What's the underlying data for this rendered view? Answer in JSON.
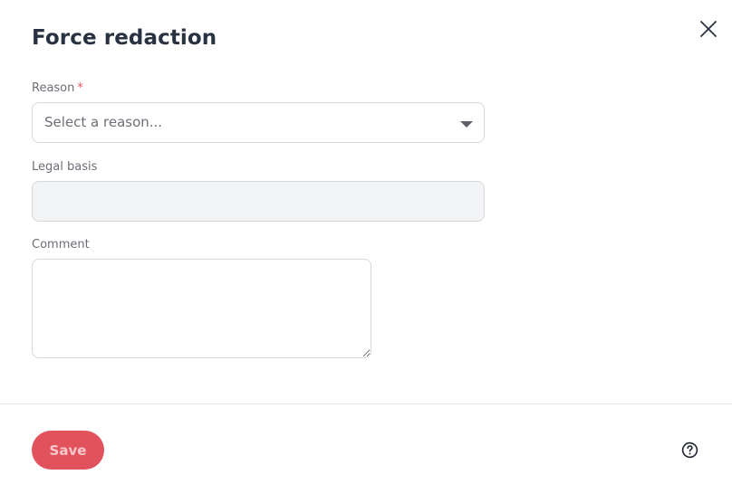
{
  "dialog": {
    "title": "Force redaction",
    "close_icon": "close-icon"
  },
  "form": {
    "reason": {
      "label": "Reason",
      "required_marker": "*",
      "placeholder": "Select a reason...",
      "dropdown_icon": "chevron-down-icon"
    },
    "legal_basis": {
      "label": "Legal basis",
      "value": ""
    },
    "comment": {
      "label": "Comment",
      "value": ""
    }
  },
  "footer": {
    "save_label": "Save",
    "help_icon": "help-circle-icon"
  },
  "colors": {
    "accent": "#e2525c",
    "text": "#283241",
    "muted": "#6b6f77",
    "border": "#d6d8dc",
    "disabled_bg": "#f2f3f4"
  }
}
